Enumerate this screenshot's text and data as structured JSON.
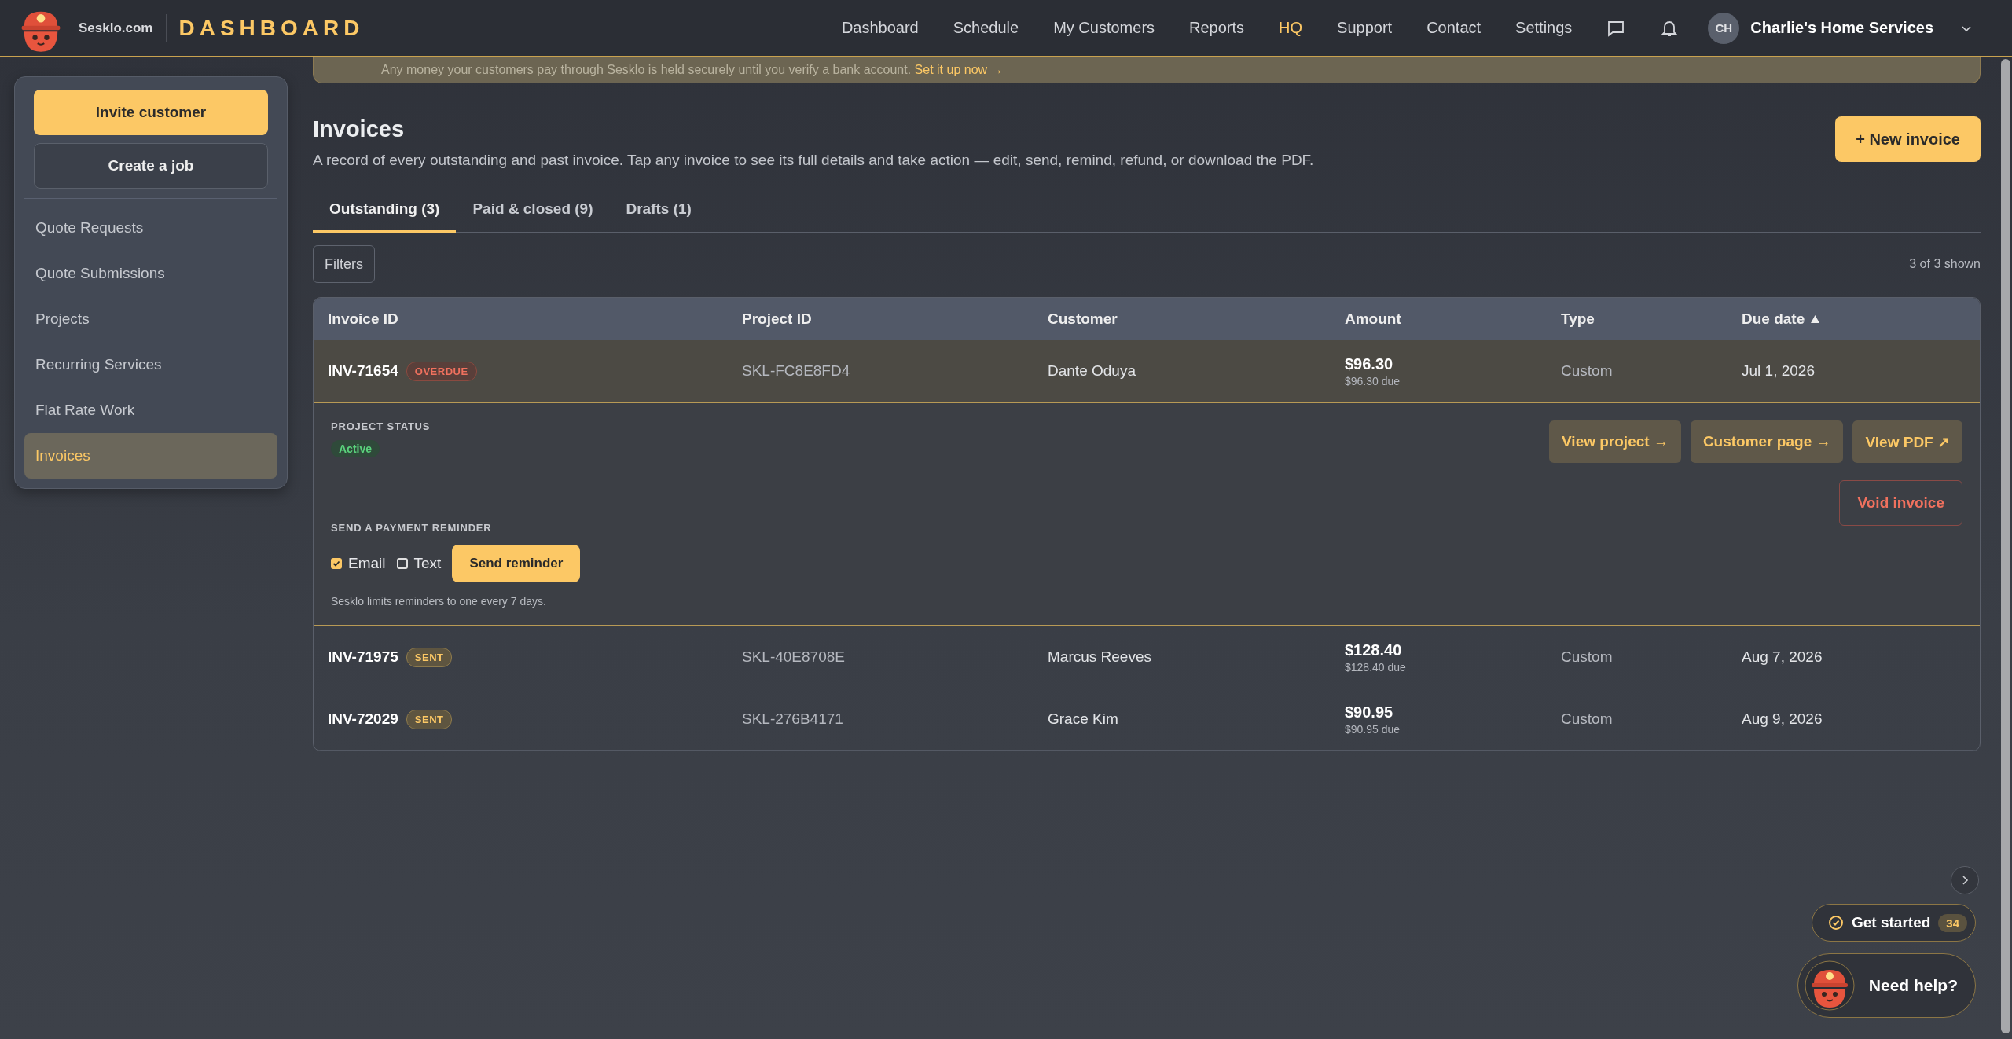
{
  "header": {
    "site": "Sesklo.com",
    "title": "DASHBOARD",
    "nav": [
      {
        "label": "Dashboard",
        "selected": false
      },
      {
        "label": "Schedule",
        "selected": false
      },
      {
        "label": "My Customers",
        "selected": false
      },
      {
        "label": "Reports",
        "selected": false
      },
      {
        "label": "HQ",
        "selected": true
      },
      {
        "label": "Support",
        "selected": false
      },
      {
        "label": "Contact",
        "selected": false
      },
      {
        "label": "Settings",
        "selected": false
      }
    ],
    "account": {
      "initials": "CH",
      "name": "Charlie's Home Services"
    }
  },
  "banner": {
    "text": "Any money your customers pay through Sesklo is held securely until you verify a bank account.",
    "link": "Set it up now →"
  },
  "sidebar": {
    "buttons": [
      {
        "label": "Invite customer",
        "kind": "primary"
      },
      {
        "label": "Create a job",
        "kind": "secondary"
      }
    ],
    "items": [
      {
        "label": "Quote Requests",
        "selected": false
      },
      {
        "label": "Quote Submissions",
        "selected": false
      },
      {
        "label": "Projects",
        "selected": false
      },
      {
        "label": "Recurring Services",
        "selected": false
      },
      {
        "label": "Flat Rate Work",
        "selected": false
      },
      {
        "label": "Invoices",
        "selected": true
      }
    ]
  },
  "page": {
    "title": "Invoices",
    "description": "A record of every outstanding and past invoice. Tap any invoice to see its full details and take action — edit, send, remind, refund, or download the PDF.",
    "new_button": "+ New invoice"
  },
  "tabs": [
    {
      "label": "Outstanding (3)",
      "selected": true
    },
    {
      "label": "Paid & closed (9)",
      "selected": false
    },
    {
      "label": "Drafts (1)",
      "selected": false
    }
  ],
  "filters": "Filters",
  "shown": "3 of 3 shown",
  "table": {
    "columns": [
      {
        "label": "Invoice ID",
        "sorted": false
      },
      {
        "label": "Project ID",
        "sorted": false
      },
      {
        "label": "Customer",
        "sorted": false
      },
      {
        "label": "Amount",
        "sorted": false
      },
      {
        "label": "Type",
        "sorted": false
      },
      {
        "label": "Due date",
        "sorted": true
      }
    ],
    "rows": [
      {
        "id": "INV-71654",
        "status": {
          "label": "OVERDUE",
          "kind": "overdue"
        },
        "project": "SKL-FC8E8FD4",
        "customer": "Dante Oduya",
        "amount": "$96.30",
        "due_amount": "$96.30 due",
        "type": "Custom",
        "due_date": "Jul 1, 2026",
        "expanded": true,
        "detail": {
          "status_label": "PROJECT STATUS",
          "status": "Active",
          "actions": [
            "View project →",
            "Customer page →",
            "View PDF ↗"
          ],
          "void": "Void invoice",
          "reminder": {
            "label": "SEND A PAYMENT REMINDER",
            "channels": [
              {
                "label": "Email",
                "checked": true
              },
              {
                "label": "Text",
                "checked": false
              }
            ],
            "button": "Send reminder",
            "note": "Sesklo limits reminders to one every 7 days."
          }
        }
      },
      {
        "id": "INV-71975",
        "status": {
          "label": "SENT",
          "kind": "sent"
        },
        "project": "SKL-40E8708E",
        "customer": "Marcus Reeves",
        "amount": "$128.40",
        "due_amount": "$128.40 due",
        "type": "Custom",
        "due_date": "Aug 7, 2026",
        "expanded": false
      },
      {
        "id": "INV-72029",
        "status": {
          "label": "SENT",
          "kind": "sent"
        },
        "project": "SKL-276B4171",
        "customer": "Grace Kim",
        "amount": "$90.95",
        "due_amount": "$90.95 due",
        "type": "Custom",
        "due_date": "Aug 9, 2026",
        "expanded": false
      }
    ]
  },
  "floating": {
    "get_started": "Get started",
    "count": "34",
    "help": "Need help?"
  }
}
